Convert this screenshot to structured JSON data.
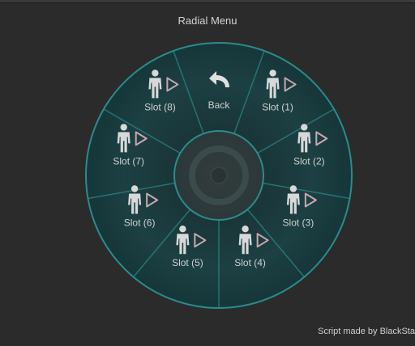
{
  "window": {
    "title": "Radial Menu"
  },
  "menu": {
    "back": {
      "label": "Back",
      "icon": "back-arrow-icon"
    },
    "slots": [
      {
        "label": "Slot (1)",
        "icon": "person-icon",
        "action_icon": "play-icon"
      },
      {
        "label": "Slot (2)",
        "icon": "person-icon",
        "action_icon": "play-icon"
      },
      {
        "label": "Slot (3)",
        "icon": "person-icon",
        "action_icon": "play-icon"
      },
      {
        "label": "Slot (4)",
        "icon": "person-icon",
        "action_icon": "play-icon"
      },
      {
        "label": "Slot (5)",
        "icon": "person-icon",
        "action_icon": "play-icon"
      },
      {
        "label": "Slot (6)",
        "icon": "person-icon",
        "action_icon": "play-icon"
      },
      {
        "label": "Slot (7)",
        "icon": "person-icon",
        "action_icon": "play-icon"
      },
      {
        "label": "Slot (8)",
        "icon": "person-icon",
        "action_icon": "play-icon"
      }
    ]
  },
  "footer": {
    "credit": "Script made by BlackSta"
  },
  "colors": {
    "background": "#2b2b2b",
    "wheel_fill": "#1b3b3e",
    "wheel_stroke": "#2a8c8c",
    "inner_ring": "#2c4446",
    "icon": "#d8d8d8",
    "play_outline": "#c9a7b1"
  }
}
